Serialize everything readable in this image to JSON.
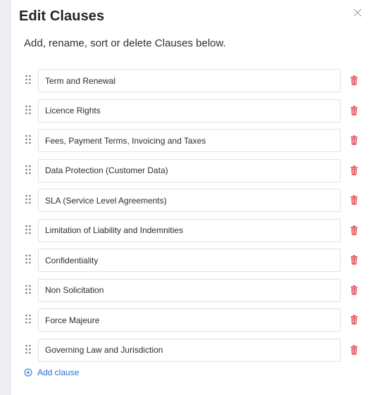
{
  "modal": {
    "title": "Edit Clauses",
    "subtitle": "Add, rename, sort or delete Clauses below."
  },
  "icons": {
    "close": "close-icon",
    "drag": "drag-handle-icon",
    "delete": "trash-icon",
    "add": "plus-circle-icon"
  },
  "clauses": [
    "Term and Renewal",
    "Licence Rights",
    "Fees, Payment Terms, Invoicing and Taxes",
    "Data Protection (Customer Data)",
    "SLA (Service Level Agreements)",
    "Limitation of Liability and Indemnities",
    "Confidentiality",
    "Non Solicitation",
    "Force Majeure",
    "Governing Law and Jurisdiction"
  ],
  "add_label": "Add clause",
  "colors": {
    "accent": "#1f6ed4",
    "delete": "#e8505b",
    "backdrop": "#eceef1"
  }
}
